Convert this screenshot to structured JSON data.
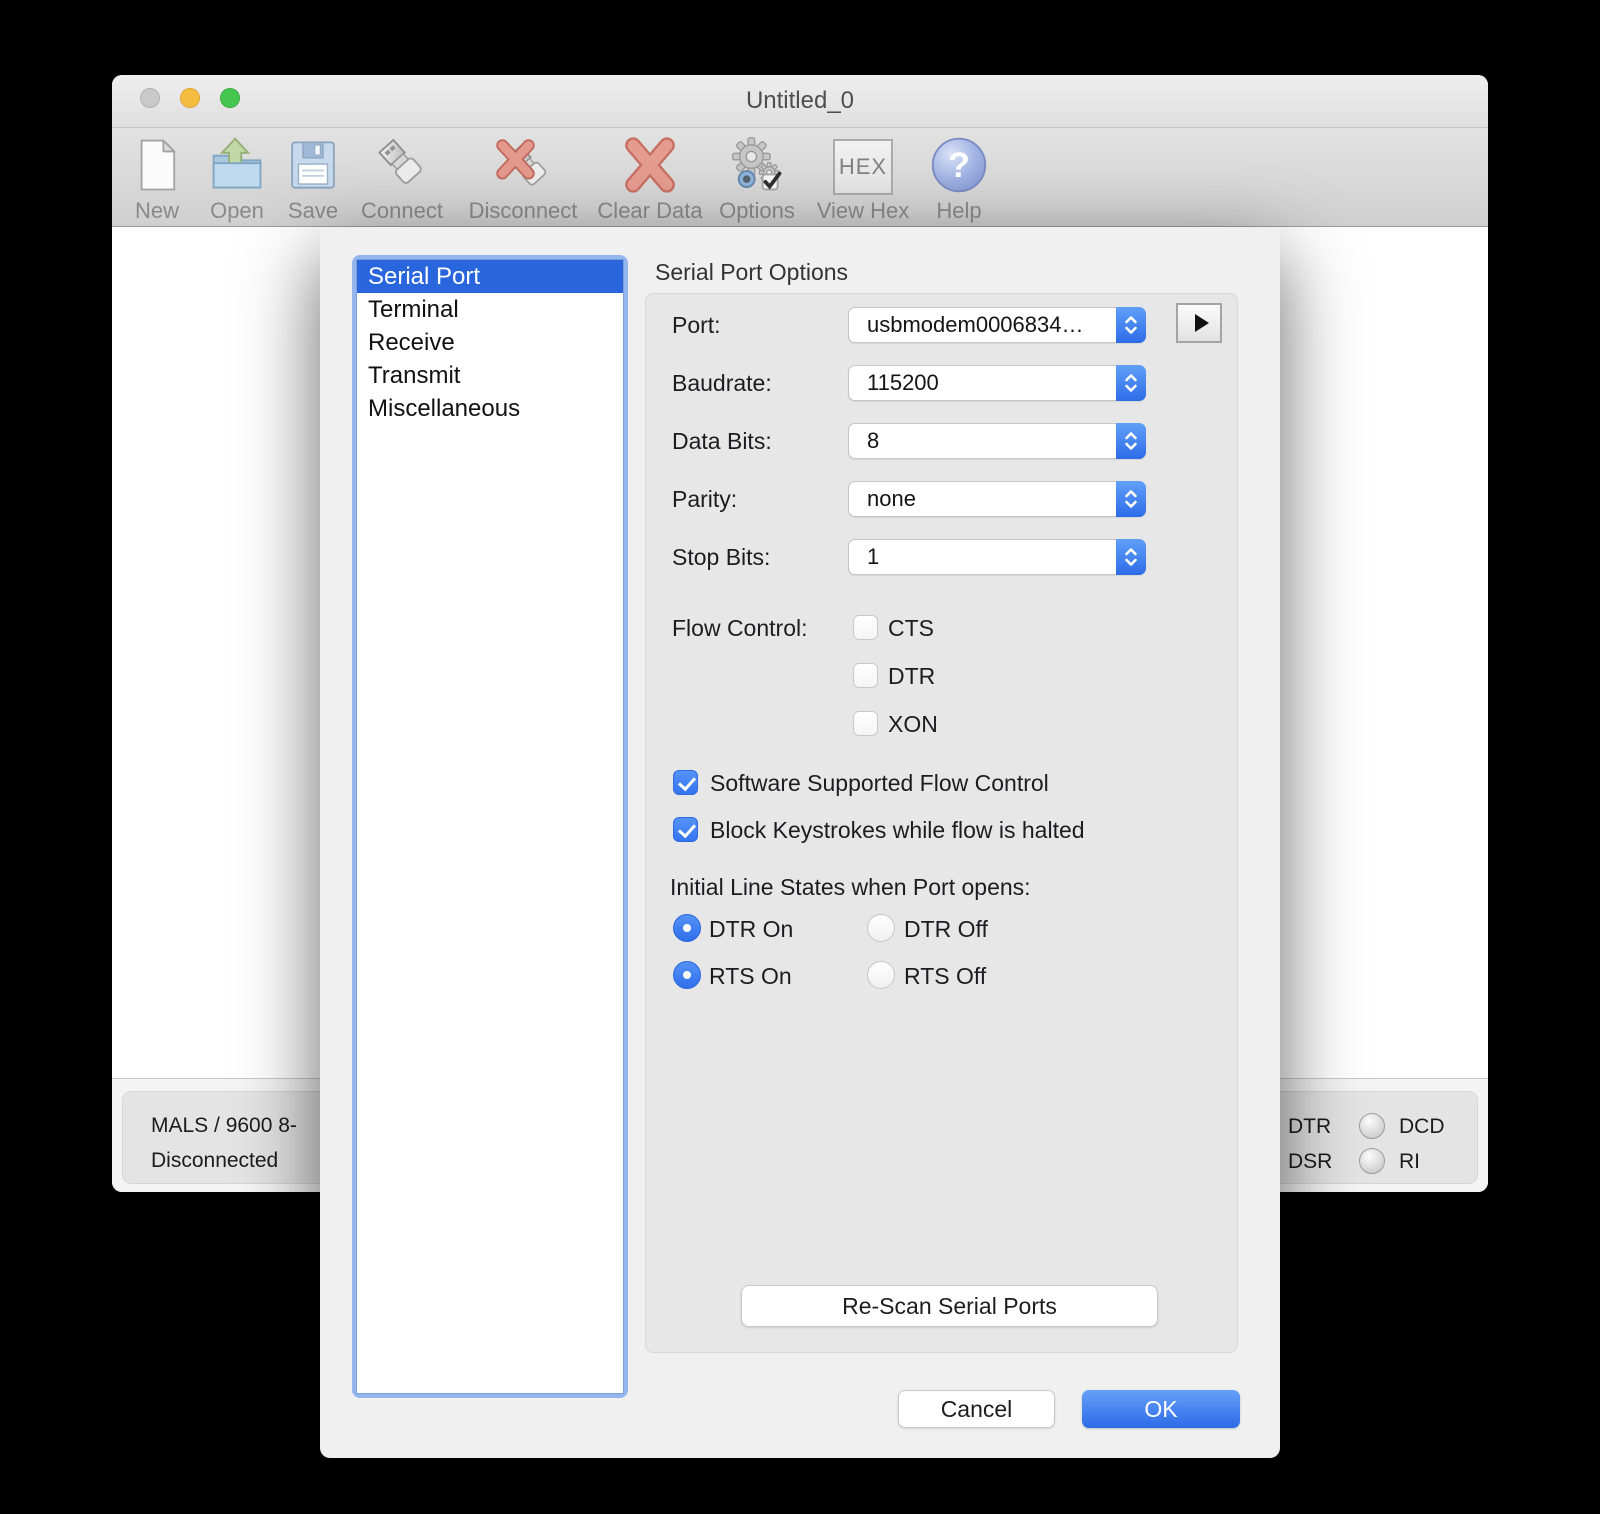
{
  "window": {
    "title": "Untitled_0",
    "toolbar": {
      "items": [
        {
          "label": "New"
        },
        {
          "label": "Open"
        },
        {
          "label": "Save"
        },
        {
          "label": "Connect"
        },
        {
          "label": "Disconnect"
        },
        {
          "label": "Clear Data"
        },
        {
          "label": "Options"
        },
        {
          "label": "View Hex"
        },
        {
          "label": "Help"
        }
      ],
      "view_hex_icon_text": "HEX"
    },
    "status_bar": {
      "connection_summary": "MALS / 9600 8-",
      "connection_state": "Disconnected",
      "line_indicators": {
        "dtr_label": "DTR",
        "dsr_label": "DSR",
        "dcd_label": "DCD",
        "ri_label": "RI"
      }
    }
  },
  "dialog": {
    "categories": [
      {
        "label": "Serial Port",
        "selected": true
      },
      {
        "label": "Terminal",
        "selected": false
      },
      {
        "label": "Receive",
        "selected": false
      },
      {
        "label": "Transmit",
        "selected": false
      },
      {
        "label": "Miscellaneous",
        "selected": false
      }
    ],
    "heading": "Serial Port Options",
    "fields": {
      "port": {
        "label": "Port:",
        "value": "usbmodem0006834…"
      },
      "baudrate": {
        "label": "Baudrate:",
        "value": "115200"
      },
      "data_bits": {
        "label": "Data Bits:",
        "value": "8"
      },
      "parity": {
        "label": "Parity:",
        "value": "none"
      },
      "stop_bits": {
        "label": "Stop Bits:",
        "value": "1"
      }
    },
    "flow_control": {
      "label": "Flow Control:",
      "options": [
        {
          "label": "CTS",
          "checked": false
        },
        {
          "label": "DTR",
          "checked": false
        },
        {
          "label": "XON",
          "checked": false
        }
      ]
    },
    "software_flow": {
      "label": "Software Supported Flow Control",
      "checked": true
    },
    "block_keystrokes": {
      "label": "Block Keystrokes while flow is halted",
      "checked": true
    },
    "initial_line_states": {
      "heading": "Initial Line States when Port opens:",
      "radios": [
        {
          "label": "DTR On",
          "selected": true
        },
        {
          "label": "DTR Off",
          "selected": false
        },
        {
          "label": "RTS On",
          "selected": true
        },
        {
          "label": "RTS Off",
          "selected": false
        }
      ]
    },
    "buttons": {
      "rescan": "Re-Scan Serial Ports",
      "cancel": "Cancel",
      "ok": "OK"
    }
  },
  "colors": {
    "selection_blue": "#2966DE",
    "control_blue": "#3D7DF5",
    "focus_ring": "#93B6EE",
    "status_panel_gray": "#E4E4E4"
  }
}
